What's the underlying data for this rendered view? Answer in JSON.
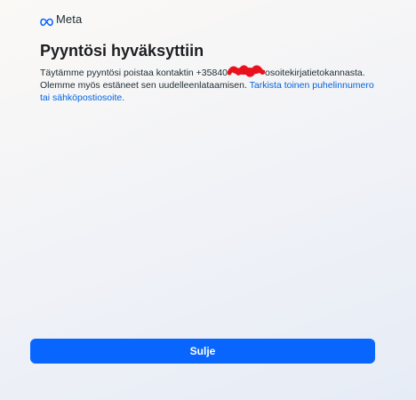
{
  "header": {
    "logo_label": "Meta",
    "logo_icon": "meta-infinity-icon"
  },
  "main": {
    "title": "Pyyntösi hyväksyttiin",
    "text_before_number": "Täytämme pyyntösi poistaa kontaktin",
    "phone_prefix": "+35840",
    "text_after_number": "osoitekirjatietokannasta. Olemme myös estäneet sen uudelleenlataamisen.",
    "link_text": "Tarkista toinen puhelinnumero tai sähköpostiosoite."
  },
  "footer": {
    "close_label": "Sulje"
  },
  "colors": {
    "accent": "#0866ff",
    "link": "#0064e0",
    "redaction": "#e8111c"
  }
}
